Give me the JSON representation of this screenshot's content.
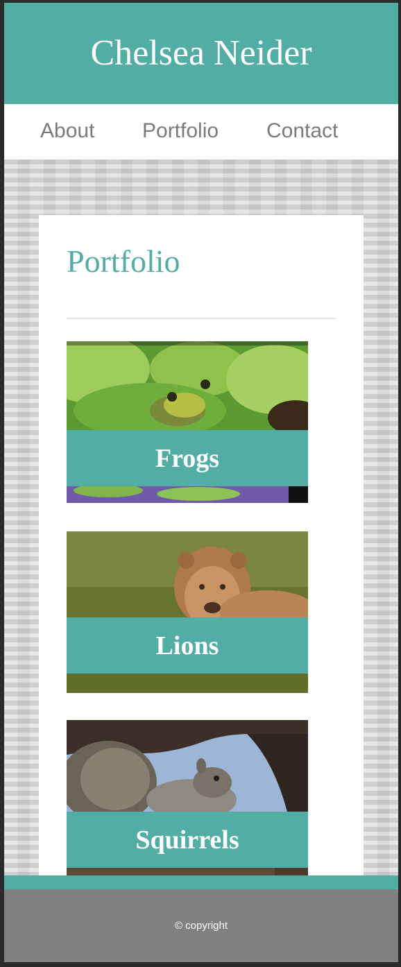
{
  "site": {
    "title": "Chelsea Neider"
  },
  "nav": {
    "items": [
      {
        "label": "About"
      },
      {
        "label": "Portfolio"
      },
      {
        "label": "Contact"
      }
    ]
  },
  "main": {
    "heading": "Portfolio",
    "tiles": [
      {
        "label": "Frogs",
        "image": "frog-on-lily-pad"
      },
      {
        "label": "Lions",
        "image": "lioness-in-grass"
      },
      {
        "label": "Squirrels",
        "image": "squirrel-on-branch"
      }
    ]
  },
  "footer": {
    "copyright": "© copyright"
  },
  "colors": {
    "accent": "#52ada5",
    "footer": "#818181",
    "nav_text": "#7a7a7a"
  }
}
